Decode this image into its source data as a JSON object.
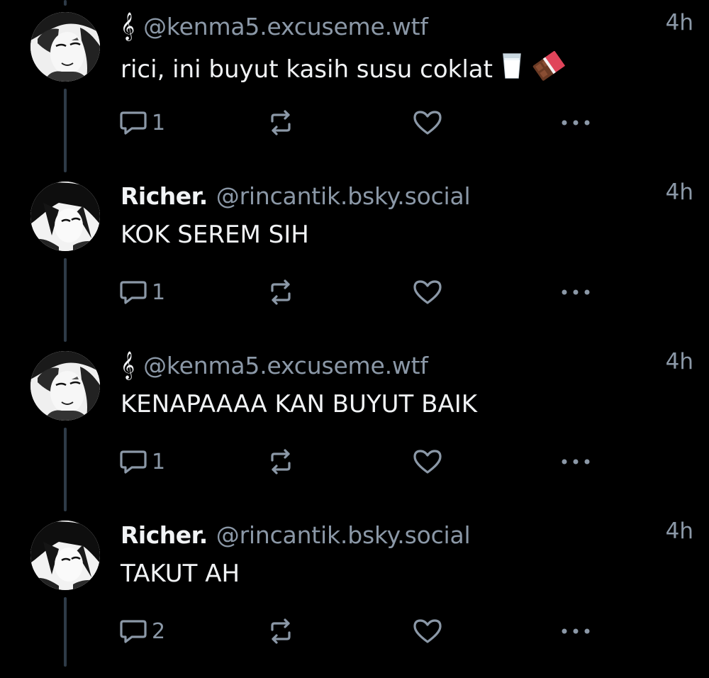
{
  "thread": {
    "posts": [
      {
        "author_display": "",
        "author_icon": "treble-clef-icon",
        "author_icon_glyph": "𝄞",
        "handle": "@kenma5.excuseme.wtf",
        "time": "4h",
        "text": "rici, ini buyut kasih susu coklat",
        "emojis": [
          "glass-of-milk-icon",
          "chocolate-bar-icon"
        ],
        "reply_count": "1",
        "avatar": "kenma-avatar"
      },
      {
        "author_display": "Richer.",
        "handle": "@rincantik.bsky.social",
        "time": "4h",
        "text": "KOK SEREM SIH",
        "reply_count": "1",
        "avatar": "richer-avatar"
      },
      {
        "author_display": "",
        "author_icon": "treble-clef-icon",
        "author_icon_glyph": "𝄞",
        "handle": "@kenma5.excuseme.wtf",
        "time": "4h",
        "text": "KENAPAAAA KAN BUYUT BAIK",
        "reply_count": "1",
        "avatar": "kenma-avatar"
      },
      {
        "author_display": "Richer.",
        "handle": "@rincantik.bsky.social",
        "time": "4h",
        "text": "TAKUT AH",
        "reply_count": "2",
        "avatar": "richer-avatar"
      }
    ]
  },
  "colors": {
    "background": "#000000",
    "primary_text": "#f1f3f5",
    "secondary_text": "#8b98a7",
    "thread_line": "#2e3a47"
  }
}
